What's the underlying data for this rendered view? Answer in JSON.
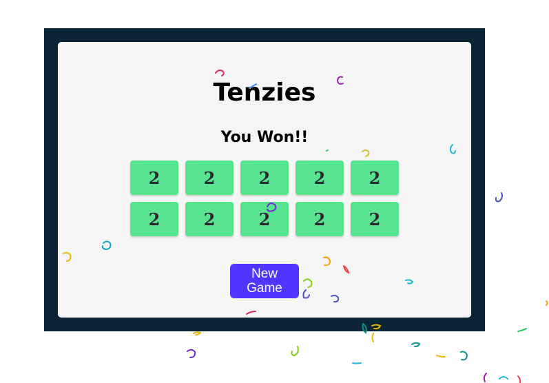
{
  "game": {
    "title": "Tenzies",
    "status": "You Won!!",
    "dice": [
      {
        "value": "2"
      },
      {
        "value": "2"
      },
      {
        "value": "2"
      },
      {
        "value": "2"
      },
      {
        "value": "2"
      },
      {
        "value": "2"
      },
      {
        "value": "2"
      },
      {
        "value": "2"
      },
      {
        "value": "2"
      },
      {
        "value": "2"
      }
    ],
    "new_game_label": "New Game"
  },
  "colors": {
    "frame": "#0b2434",
    "card": "#f5f5f5",
    "die": "#59e391",
    "button": "#5035ff"
  }
}
